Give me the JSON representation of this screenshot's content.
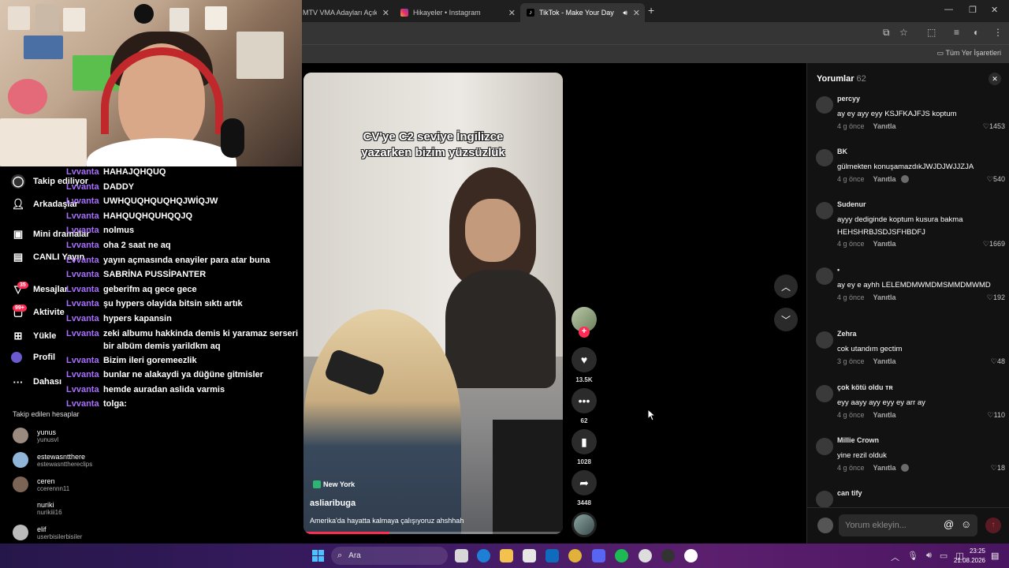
{
  "browser": {
    "tabs": [
      {
        "label": "MTV VMA Adayları Açıkla",
        "active": false
      },
      {
        "label": "Hikayeler • Instagram",
        "active": false
      },
      {
        "label": "TikTok - Make Your Day",
        "active": true
      }
    ],
    "bookmarks_all": "Tüm Yer İşaretleri"
  },
  "sidebar": {
    "items": [
      {
        "label": "Takip ediliyor",
        "icon": "following-icon"
      },
      {
        "label": "Arkadaşlar",
        "icon": "friends-icon"
      },
      {
        "label": "Mini dramalar",
        "icon": "mini-drama-icon"
      },
      {
        "label": "CANLI Yayın",
        "icon": "live-icon"
      },
      {
        "label": "Mesajlar",
        "icon": "messages-icon",
        "badge": "35"
      },
      {
        "label": "Aktivite",
        "icon": "activity-icon",
        "badge": "99+"
      },
      {
        "label": "Yükle",
        "icon": "upload-icon"
      },
      {
        "label": "Profil",
        "icon": "profile-icon"
      },
      {
        "label": "Dahası",
        "icon": "more-icon"
      }
    ],
    "following_title": "Takip edilen hesaplar",
    "accounts": [
      {
        "name": "yunus",
        "handle": "yunusvl"
      },
      {
        "name": "estewasntthere",
        "handle": "estewasnttherecl​ips"
      },
      {
        "name": "ceren",
        "handle": "ccerennn11"
      },
      {
        "name": "nuriki",
        "handle": "nurikiii16"
      },
      {
        "name": "elif",
        "handle": "userbisilerbisiler"
      }
    ]
  },
  "chat": [
    {
      "user": "Lvvanta",
      "msg": "HAHAJQHQUQ"
    },
    {
      "user": "Lvvanta",
      "msg": "DADDY"
    },
    {
      "user": "Lvvanta",
      "msg": "UWHQUQHQUQHQJWİQJW"
    },
    {
      "user": "Lvvanta",
      "msg": "HAHQUQHQUHQQJQ"
    },
    {
      "user": "Lvvanta",
      "msg": "nolmus"
    },
    {
      "user": "Lvvanta",
      "msg": "oha 2 saat ne aq"
    },
    {
      "user": "Lvvanta",
      "msg": "yayın açmasında enayiler para atar buna"
    },
    {
      "user": "Lvvanta",
      "msg": "SABRİNA PUSSİPANTER"
    },
    {
      "user": "Lvvanta",
      "msg": "geberifm aq gece gece"
    },
    {
      "user": "Lvvanta",
      "msg": "şu hypers olayida bitsin sıktı artık"
    },
    {
      "user": "Lvvanta",
      "msg": "hypers kapansin"
    },
    {
      "user": "Lvvanta",
      "msg": "zeki albumu hakkinda demis ki yaramaz serseri bir albüm demis yarildkm aq"
    },
    {
      "user": "Lvvanta",
      "msg": "Bizim ileri goremeezlik"
    },
    {
      "user": "Lvvanta",
      "msg": "bunlar ne alakaydi ya düğüne gitmisler"
    },
    {
      "user": "Lvvanta",
      "msg": "hemde auradan aslida varmis"
    },
    {
      "user": "Lvvanta",
      "msg": "tolga:"
    }
  ],
  "video": {
    "caption_line1": "CV'ye C2 seviye İngilizce",
    "caption_line2": "yazarken bizim yüzsüzlük",
    "location": "New York",
    "author": "asliaribuga",
    "description": "Amerika'da hayatta kalmaya çalışıyoruz ahshhah",
    "progress": 0.33
  },
  "actions": {
    "likes": "13.5K",
    "comments": "62",
    "saves": "1028",
    "shares": "3448"
  },
  "comments": {
    "title": "Yorumlar",
    "count": "62",
    "items": [
      {
        "user": "percyy",
        "text": "ay ey ayy eyy KSJFKAJFJS koptum",
        "time": "4 g önce",
        "reply": "Yanıtla",
        "likes": "1453",
        "author_liked": false
      },
      {
        "user": "BK",
        "text": "gülmekten konuşamazdıkJWJDJWJJZJA",
        "time": "4 g önce",
        "reply": "Yanıtla",
        "likes": "540",
        "author_liked": true
      },
      {
        "user": "Sudenur",
        "text": "ayyy dediginde koptum kusura bakma HEHSHRBJSDJSFHBDFJ",
        "time": "4 g önce",
        "reply": "Yanıtla",
        "likes": "1669",
        "author_liked": false
      },
      {
        "user": "•",
        "text": "ay ey e ayhh LELEMDMWMDMSMMDMWMD",
        "time": "4 g önce",
        "reply": "Yanıtla",
        "likes": "192",
        "author_liked": false
      },
      {
        "user": "Zehra",
        "text": "cok utandım gectim",
        "time": "3 g önce",
        "reply": "Yanıtla",
        "likes": "48",
        "author_liked": false
      },
      {
        "user": "çok kötü oldu ᴛʀ",
        "text": "eyy aayy ayy eyy ey arr ay",
        "time": "4 g önce",
        "reply": "Yanıtla",
        "likes": "110",
        "author_liked": false
      },
      {
        "user": "Millie Crown",
        "text": "yine rezil olduk",
        "time": "4 g önce",
        "reply": "Yanıtla",
        "likes": "18",
        "author_liked": true
      },
      {
        "user": "can tify",
        "text": "",
        "time": "",
        "reply": "",
        "likes": "",
        "author_liked": false
      }
    ],
    "input_placeholder": "Yorum ekleyin..."
  },
  "taskbar": {
    "search": "Ara",
    "time": "23:25",
    "date": "21.08.2026"
  }
}
